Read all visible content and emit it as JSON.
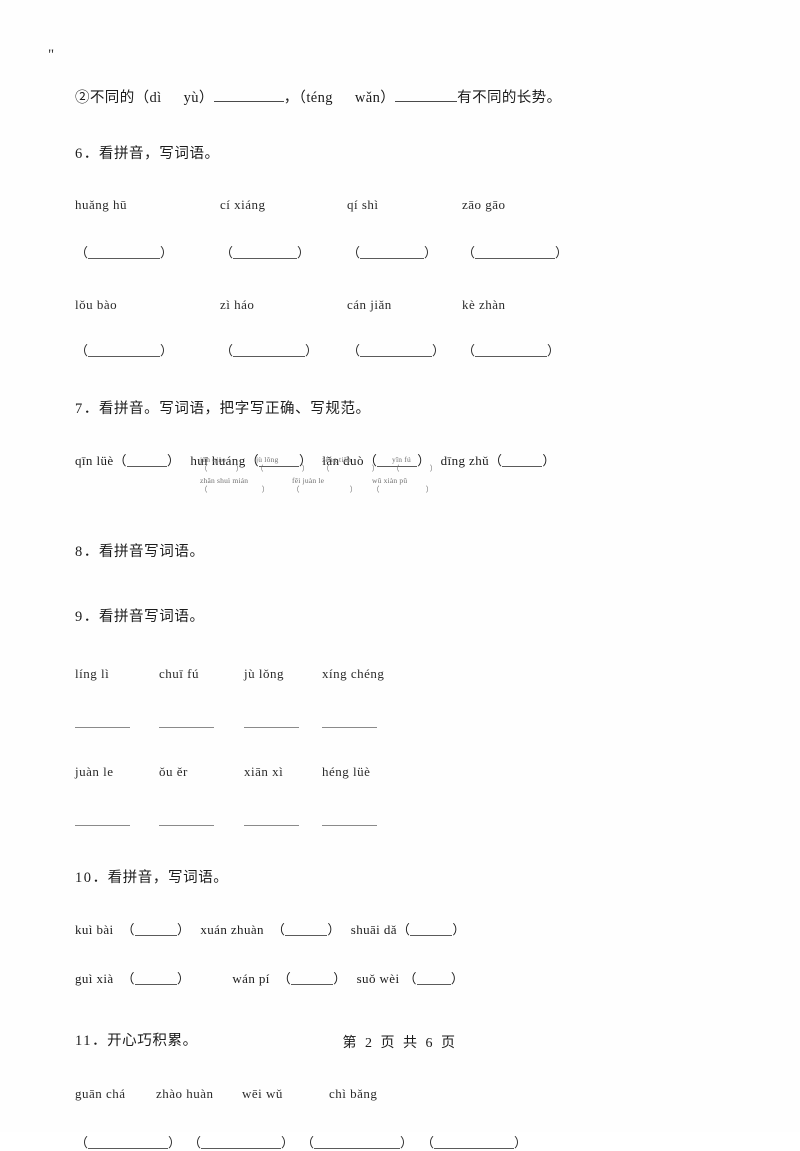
{
  "page": {
    "stray_mark": "\"",
    "footer": "第 2 页 共 6 页"
  },
  "q5_continuation": {
    "prefix": "②不同的（dì",
    "pinyin_a_second": "yù）",
    "middle": "，（téng",
    "pinyin_b_second": "wǎn）",
    "suffix": "有不同的长势。",
    "full_text": "②不同的（dì  yù）________，（téng  wǎn）_______有不同的长势。"
  },
  "questions": [
    {
      "number": "6",
      "title": "．看拼音，写词语。",
      "rows": [
        {
          "pinyin": [
            "huǎng hū",
            "cí xiáng",
            "qí shì",
            "zāo gāo"
          ]
        },
        {
          "pinyin": [
            "lǒu bào",
            "zì  háo",
            "cán jiǎn",
            "kè zhàn"
          ]
        }
      ]
    },
    {
      "number": "7",
      "title": "．看拼音。写词语，把字写正确、写规范。",
      "items": [
        "qīn lüè",
        "huī huáng",
        "lǎn duò",
        "dīng zhǔ"
      ]
    },
    {
      "number": "8",
      "title": "．看拼音写词语。",
      "tiny_rows": [
        [
          "jūn qiào",
          "jù lǒng",
          "zēng tiān",
          "yīn fú"
        ],
        [
          "zhǎn shuì mián",
          "fēi juàn le",
          "wǔ xiàn pǔ"
        ]
      ]
    },
    {
      "number": "9",
      "title": "．看拼音写词语。",
      "rows": [
        {
          "pinyin": [
            "líng lì",
            "chuī fú",
            "jù lǒng",
            "xíng chéng"
          ]
        },
        {
          "pinyin": [
            "juàn le",
            "ǒu ěr",
            "xiān xì",
            "héng lüè"
          ]
        }
      ]
    },
    {
      "number": "10",
      "title": "．看拼音，写词语。",
      "rows": [
        [
          "kuì bài",
          "xuán zhuàn",
          "shuāi dǎ"
        ],
        [
          "guì xià",
          "wán pí",
          "suǒ wèi"
        ]
      ]
    },
    {
      "number": "11",
      "title": "．开心巧积累。",
      "pinyin": [
        "guān chá",
        "zhào huàn",
        "wēi wǔ",
        "chì bǎng"
      ]
    }
  ]
}
